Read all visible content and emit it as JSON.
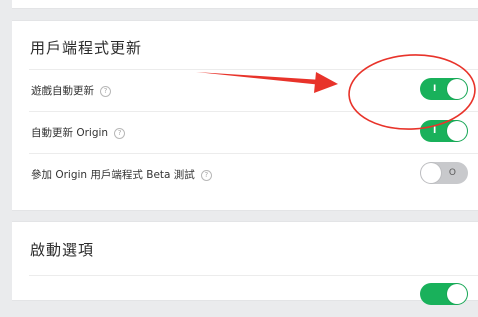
{
  "client_section": {
    "title": "用戶端程式更新",
    "rows": [
      {
        "label": "遊戲自動更新",
        "help": "?",
        "toggle_state": "on",
        "toggle_mark": "I"
      },
      {
        "label": "自動更新 Origin",
        "help": "?",
        "toggle_state": "on",
        "toggle_mark": "I"
      },
      {
        "label": "參加 Origin 用戶端程式 Beta 測試",
        "help": "?",
        "toggle_state": "off",
        "toggle_mark": "O"
      }
    ]
  },
  "launch_section": {
    "title": "啟動選項"
  },
  "colors": {
    "toggle_on": "#19b15b",
    "toggle_off": "#c8c9cc",
    "annotation_red": "#e8332a"
  },
  "icons": [
    "help-icon",
    "red-arrow",
    "red-circle"
  ]
}
